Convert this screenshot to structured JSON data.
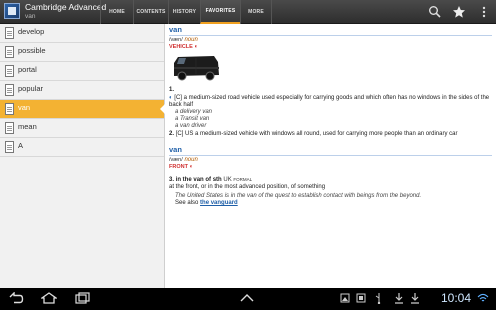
{
  "app": {
    "title": "Cambridge Advanced",
    "subtitle": "van"
  },
  "tabs": [
    {
      "label": "HOME"
    },
    {
      "label": "CONTENTS"
    },
    {
      "label": "HISTORY"
    },
    {
      "label": "FAVORITES",
      "active": true
    },
    {
      "label": "MORE"
    }
  ],
  "actions": {
    "search_icon": "search-icon",
    "favorite_icon": "star-icon",
    "menu_icon": "overflow-menu-icon"
  },
  "sidebar": {
    "items": [
      {
        "label": "develop"
      },
      {
        "label": "possible"
      },
      {
        "label": "portal"
      },
      {
        "label": "popular"
      },
      {
        "label": "van",
        "selected": true
      },
      {
        "label": "mean"
      },
      {
        "label": "A"
      }
    ]
  },
  "entry": {
    "e1": {
      "headword": "van",
      "pron": "/væn/",
      "pos": "noun",
      "guide": "VEHICLE",
      "sense1_num": "1.",
      "sense1_text": "[C] a medium-sized road vehicle used especially for carrying goods and which often has no windows in the sides of the back half",
      "ex1": "a delivery van",
      "ex2": "a Transit van",
      "ex3": "a van driver",
      "sense2_num": "2.",
      "sense2_text": "[C] US a medium-sized vehicle with windows all round, used for carrying more people than an ordinary car"
    },
    "e2": {
      "headword": "van",
      "pron": "/væn/",
      "pos": "noun",
      "guide": "FRONT",
      "sense3_num": "3.",
      "phrase": "in the van of sth",
      "region": "UK",
      "register": "FORMAL",
      "def": "at the front, or in the most advanced position, of something",
      "ex": "The United States is in the van of the quest to establish contact with beings from the beyond.",
      "see_also": "See also",
      "see_also_link": "the vanguard"
    }
  },
  "status": {
    "time": "10:04"
  },
  "colors": {
    "accent": "#f3b233",
    "headword": "#1f5fa8",
    "action_bar": "#3a3a3a"
  }
}
